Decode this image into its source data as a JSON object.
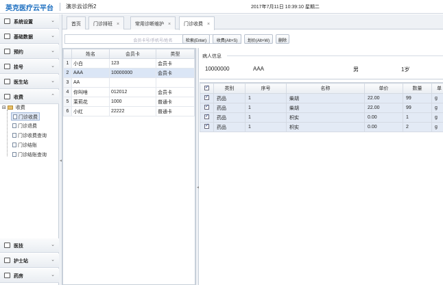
{
  "header": {
    "brand": "英克医疗云平台",
    "clinic": "演示云诊所2",
    "datetime": "2017年7月11日 10:39:10 星期二"
  },
  "sidebar": {
    "items": [
      {
        "label": "系统设置",
        "icon": "settings-icon"
      },
      {
        "label": "基础数据",
        "icon": "database-icon"
      },
      {
        "label": "预约",
        "icon": "calendar-icon"
      },
      {
        "label": "挂号",
        "icon": "register-icon"
      },
      {
        "label": "医生站",
        "icon": "doctor-icon"
      },
      {
        "label": "收费",
        "icon": "charge-icon"
      }
    ],
    "bottom_items": [
      {
        "label": "医技",
        "icon": "medtech-icon"
      },
      {
        "label": "护士站",
        "icon": "nurse-icon"
      },
      {
        "label": "药房",
        "icon": "pharmacy-icon"
      }
    ],
    "tree": {
      "root": "收费",
      "leaves": [
        "门诊收费",
        "门诊退费",
        "门诊收费查询",
        "门诊结账",
        "门诊结账查询"
      ]
    }
  },
  "tabs": [
    {
      "label": "首页",
      "closable": false
    },
    {
      "label": "门诊排班",
      "closable": true
    },
    {
      "label": "常用诊断维护",
      "closable": true
    },
    {
      "label": "门诊收费",
      "closable": true,
      "active": true
    }
  ],
  "toolbar": {
    "search_placeholder": "会员卡号/手机号/姓名",
    "query": "检索(Enter)",
    "charge": "收费(Alt+S)",
    "price": "划价(Alt+W)",
    "delete": "删除"
  },
  "patients": {
    "columns": [
      "姓名",
      "会员卡",
      "类型"
    ],
    "rows": [
      {
        "idx": "1",
        "name": "小白",
        "card": "123",
        "type": "会员卡"
      },
      {
        "idx": "2",
        "name": "AAA",
        "card": "10000000",
        "type": "会员卡"
      },
      {
        "idx": "3",
        "name": "AA",
        "card": "",
        "type": ""
      },
      {
        "idx": "4",
        "name": "你叫啥",
        "card": "012012",
        "type": "会员卡"
      },
      {
        "idx": "5",
        "name": "茉莉花",
        "card": "1000",
        "type": "普通卡"
      },
      {
        "idx": "6",
        "name": "小红",
        "card": "22222",
        "type": "普通卡"
      }
    ],
    "selected": 1
  },
  "patient_info": {
    "legend": "病人信息",
    "card": "10000000",
    "name": "AAA",
    "sex": "男",
    "age": "1岁"
  },
  "items": {
    "columns": [
      "类别",
      "序号",
      "名称",
      "单价",
      "数量",
      "单"
    ],
    "rows": [
      {
        "category": "药品",
        "seq": "1",
        "name": "柴胡",
        "price": "22.00",
        "qty": "99",
        "unit": "g"
      },
      {
        "category": "药品",
        "seq": "1",
        "name": "柴胡",
        "price": "22.00",
        "qty": "99",
        "unit": "g"
      },
      {
        "category": "药品",
        "seq": "1",
        "name": "枳实",
        "price": "0.00",
        "qty": "1",
        "unit": "g"
      },
      {
        "category": "药品",
        "seq": "1",
        "name": "枳实",
        "price": "0.00",
        "qty": "2",
        "unit": "g"
      }
    ]
  }
}
